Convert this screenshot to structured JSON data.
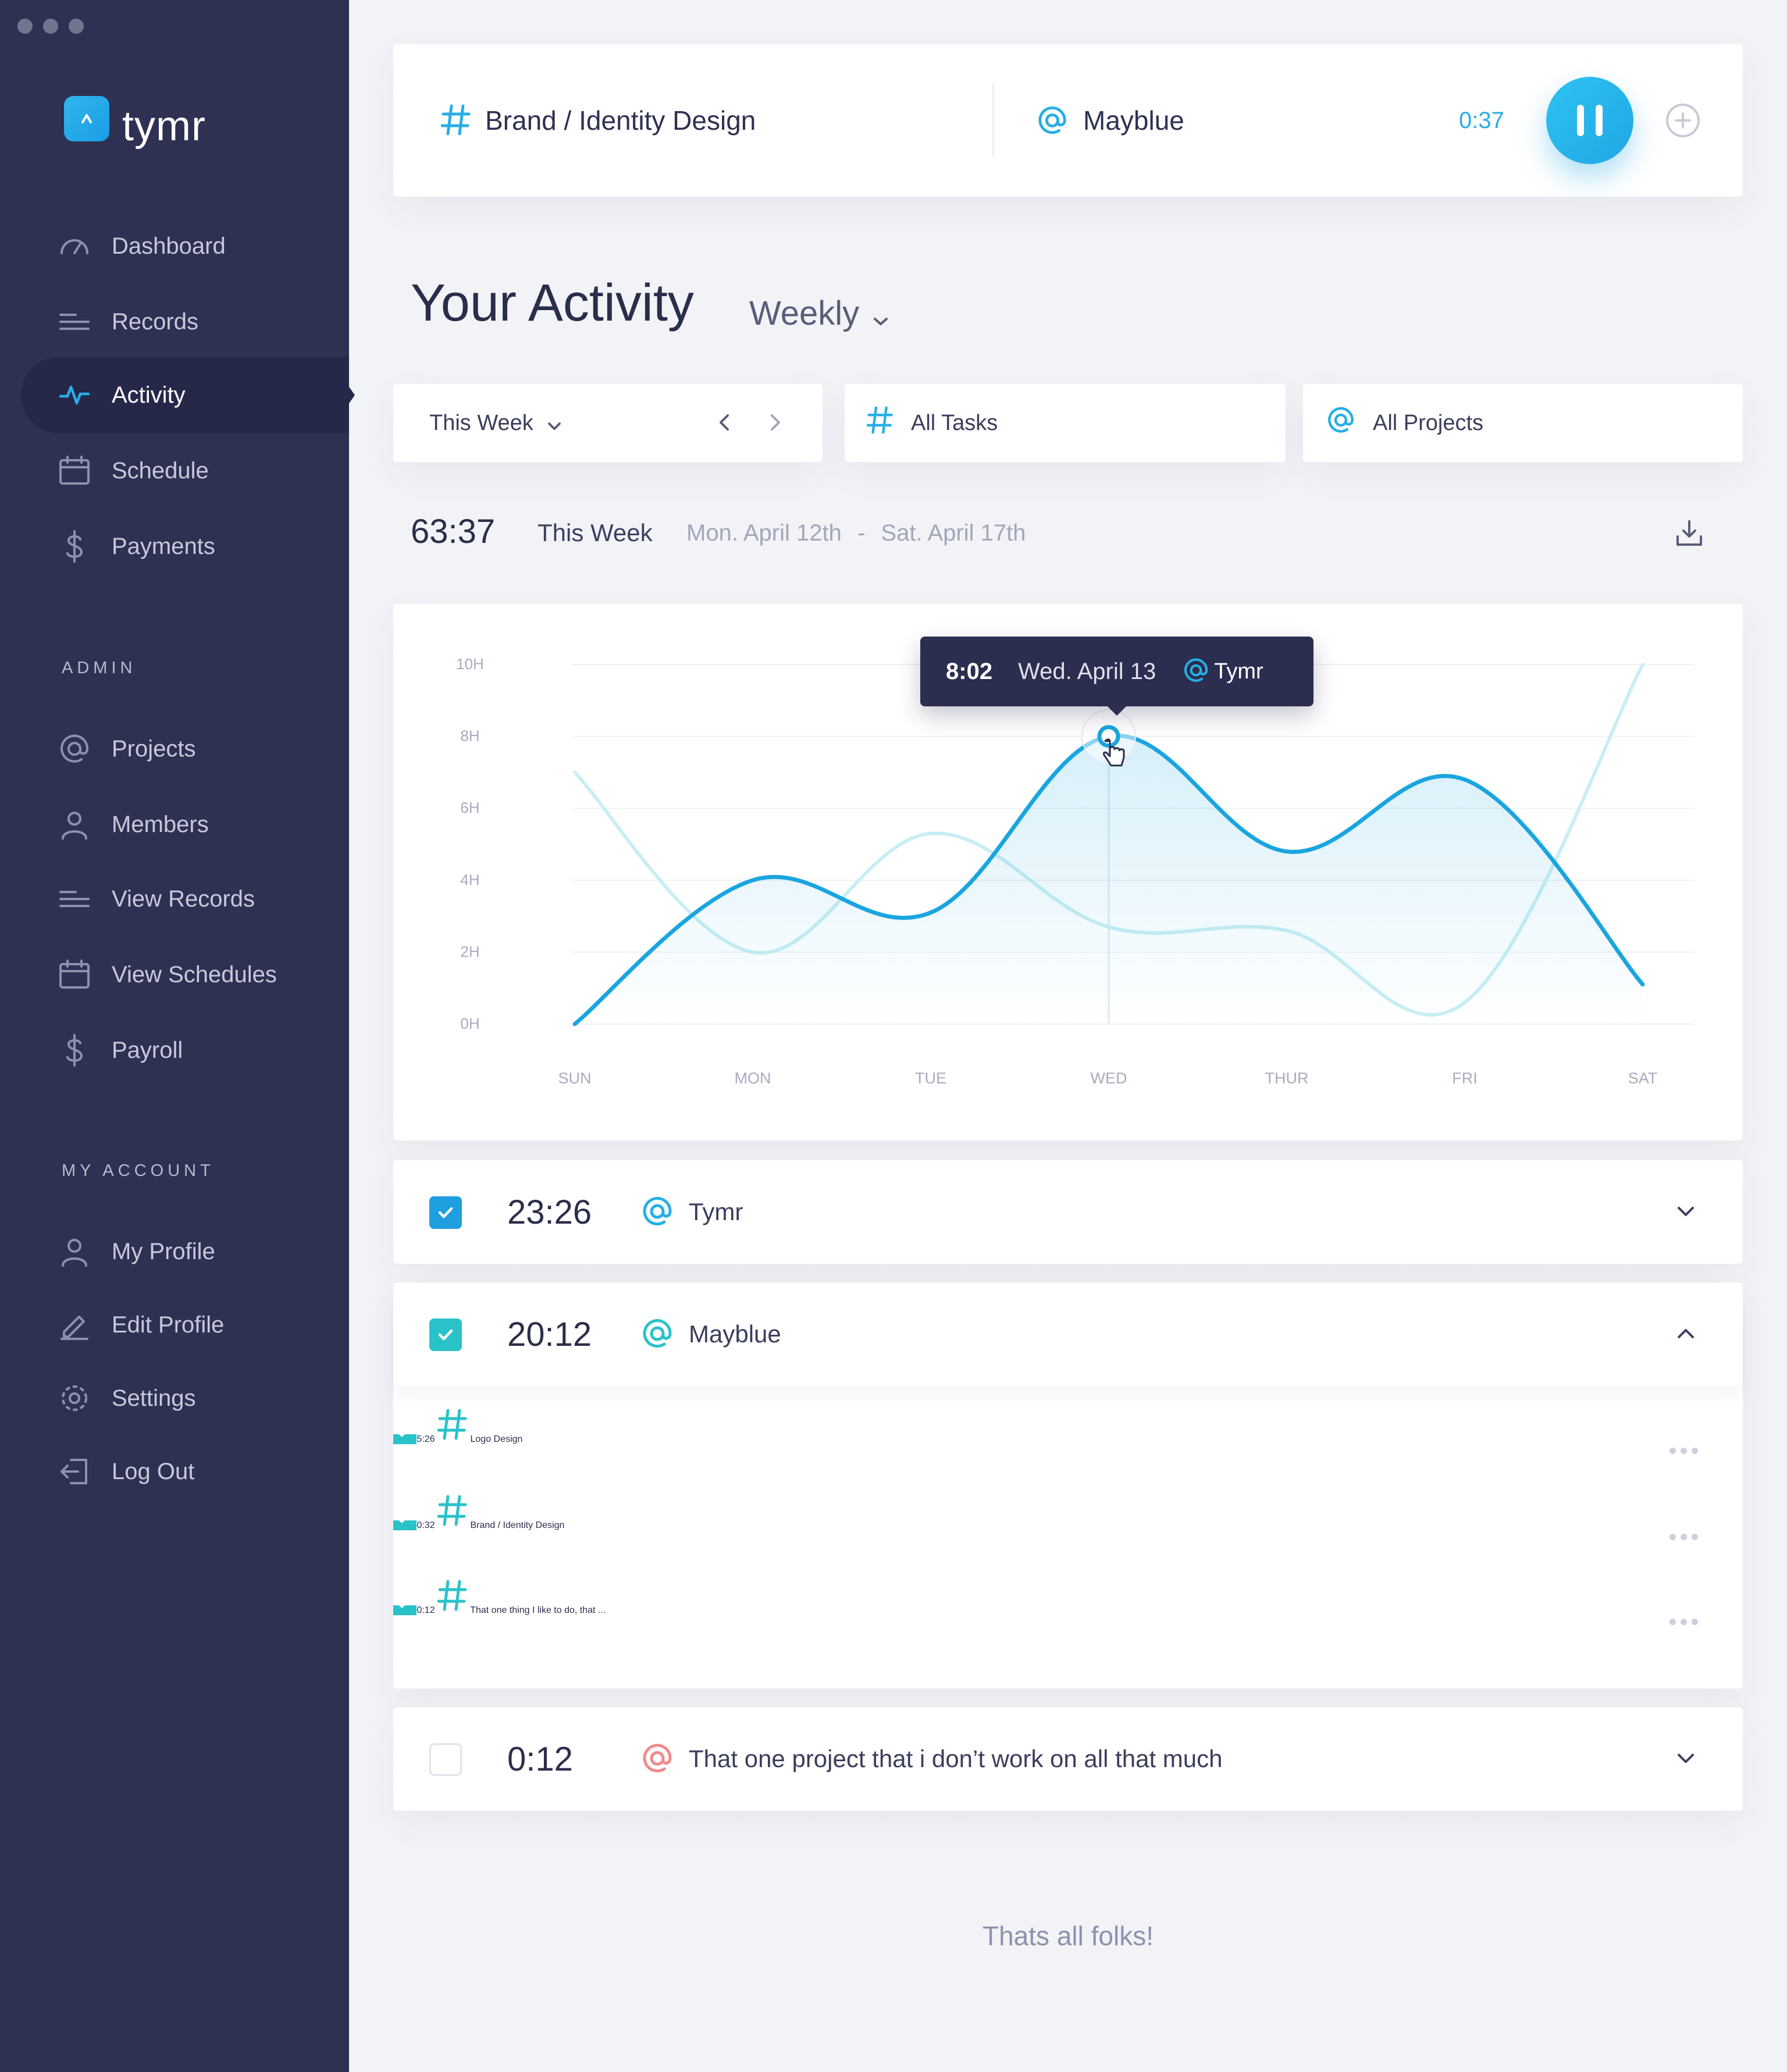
{
  "app": {
    "name": "tymr"
  },
  "nav": {
    "main": [
      {
        "label": "Dashboard",
        "icon": "gauge-icon"
      },
      {
        "label": "Records",
        "icon": "lines-icon"
      },
      {
        "label": "Activity",
        "icon": "pulse-icon",
        "active": true
      },
      {
        "label": "Schedule",
        "icon": "calendar-icon"
      },
      {
        "label": "Payments",
        "icon": "dollar-icon"
      }
    ],
    "admin_label": "ADMIN",
    "admin": [
      {
        "label": "Projects",
        "icon": "at-icon"
      },
      {
        "label": "Members",
        "icon": "user-icon"
      },
      {
        "label": "View Records",
        "icon": "lines-icon"
      },
      {
        "label": "View Schedules",
        "icon": "calendar-icon"
      },
      {
        "label": "Payroll",
        "icon": "dollar-icon"
      }
    ],
    "account_label": "MY ACCOUNT",
    "account": [
      {
        "label": "My Profile",
        "icon": "user-icon"
      },
      {
        "label": "Edit Profile",
        "icon": "pencil-icon"
      },
      {
        "label": "Settings",
        "icon": "gear-icon"
      },
      {
        "label": "Log Out",
        "icon": "logout-icon"
      }
    ]
  },
  "timer": {
    "task": "Brand / Identity Design",
    "project": "Mayblue",
    "elapsed": "0:37",
    "state": "running"
  },
  "activity": {
    "title": "Your Activity",
    "period": "Weekly",
    "filters": {
      "week": "This Week",
      "tasks": "All Tasks",
      "projects": "All Projects"
    },
    "summary": {
      "total": "63:37",
      "label": "This Week",
      "range_start": "Mon. April 12th",
      "range_sep": "-",
      "range_end": "Sat. April 17th"
    }
  },
  "tooltip": {
    "value": "8:02",
    "date": "Wed. April 13",
    "project": "Tymr"
  },
  "chart_data": {
    "type": "line",
    "categories": [
      "SUN",
      "MON",
      "TUE",
      "WED",
      "THUR",
      "FRI",
      "SAT"
    ],
    "y_ticks": [
      "0H",
      "2H",
      "4H",
      "6H",
      "8H",
      "10H"
    ],
    "ylim": [
      0,
      10
    ],
    "grid": true,
    "series": [
      {
        "values": [
          0,
          4,
          3.1,
          8.0,
          4.8,
          6.8,
          1.1
        ],
        "color": "#1aa5e0",
        "emphasis": "primary"
      },
      {
        "values": [
          7.0,
          2.0,
          5.3,
          2.7,
          2.6,
          0.6,
          10.0
        ],
        "color": "#c9eef3",
        "emphasis": "secondary"
      }
    ],
    "highlight": {
      "category": "WED",
      "value": 8.0
    }
  },
  "rows": [
    {
      "time": "23:26",
      "tag": "@",
      "label": "Tymr",
      "checked": true,
      "check_color": "#1f9fe0",
      "expanded": false
    },
    {
      "time": "20:12",
      "tag": "@",
      "label": "Mayblue",
      "checked": true,
      "check_color": "#29c2c9",
      "expanded": true,
      "subtasks": [
        {
          "time": "5:26",
          "tag": "#",
          "label": "Logo Design"
        },
        {
          "time": "0:32",
          "tag": "#",
          "label": "Brand / Identity Design"
        },
        {
          "time": "0:12",
          "tag": "#",
          "label": "That one thing I like to do, that ..."
        }
      ]
    },
    {
      "time": "0:12",
      "tag": "@",
      "label": "That one project that i don’t work on all that much",
      "checked": false,
      "tag_color": "#f08a8a",
      "expanded": false
    }
  ],
  "footer": "Thats all folks!",
  "colors": {
    "sidebar": "#2e3152",
    "accent": "#27aee6",
    "teal": "#29c2c9",
    "coral": "#f08a8a"
  }
}
